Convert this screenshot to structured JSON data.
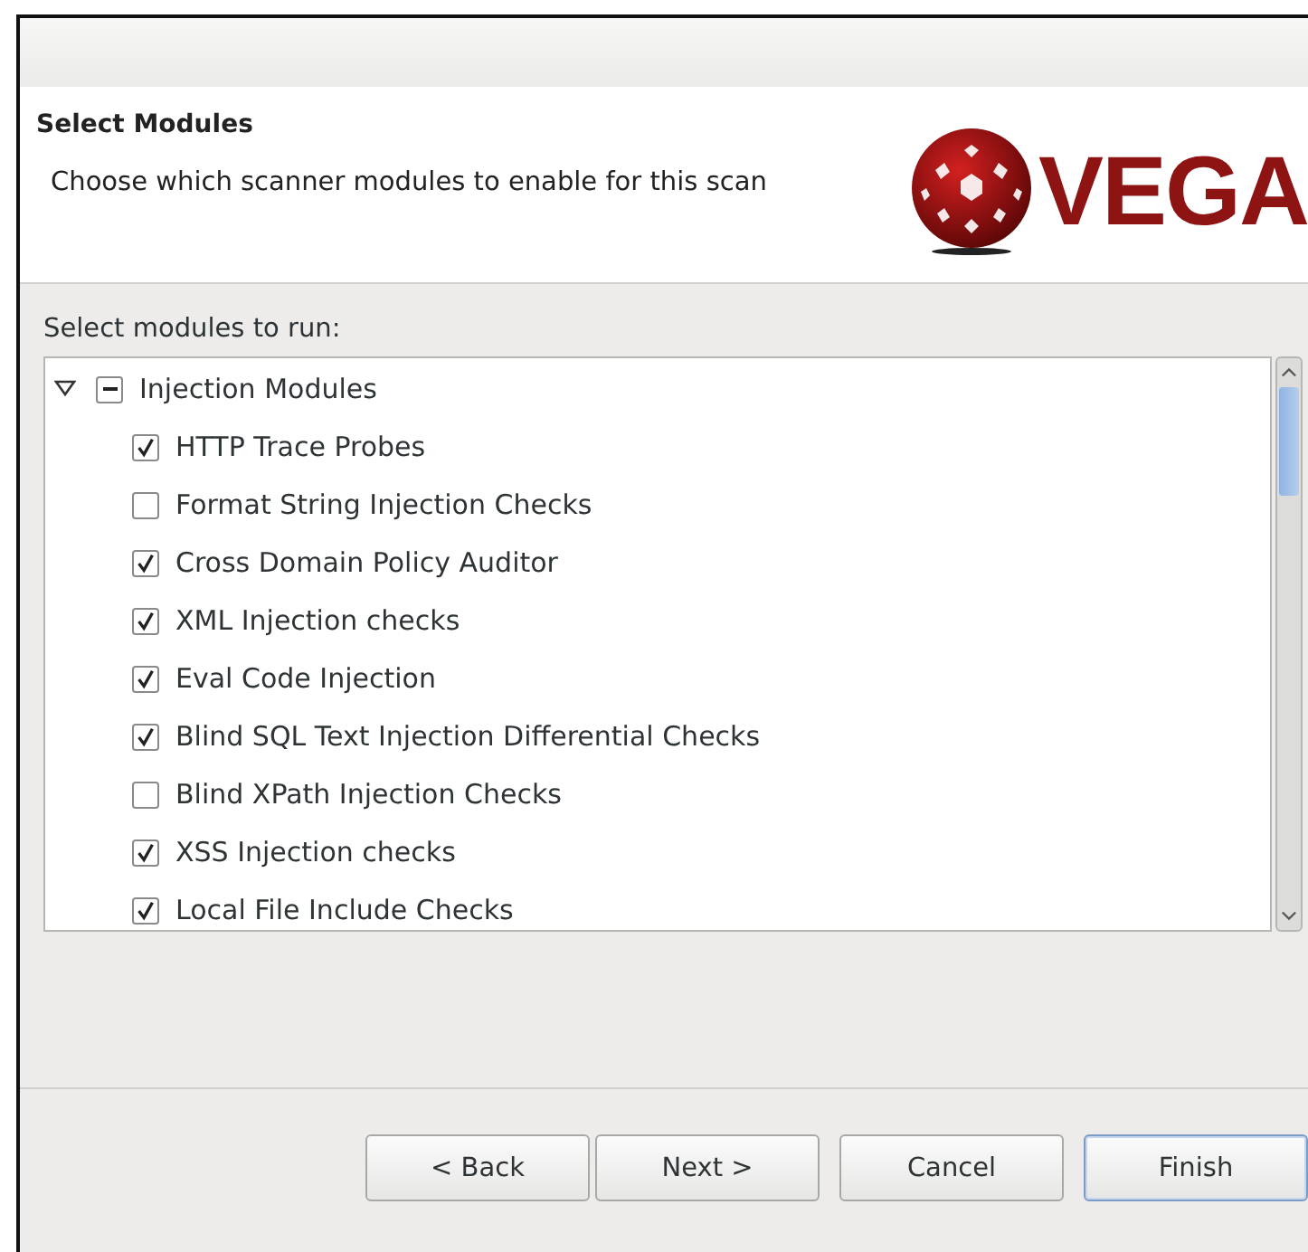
{
  "header": {
    "title": "Select Modules",
    "description": "Choose which scanner modules to enable for this scan",
    "logo_text": "VEGA"
  },
  "modules_label": "Select modules to run:",
  "tree": [
    {
      "label": "Injection Modules",
      "expanded": true,
      "partial": true,
      "children": [
        {
          "label": "HTTP Trace Probes",
          "checked": true
        },
        {
          "label": "Format String Injection Checks",
          "checked": false
        },
        {
          "label": "Cross Domain Policy Auditor",
          "checked": true
        },
        {
          "label": "XML Injection checks",
          "checked": true
        },
        {
          "label": "Eval Code Injection",
          "checked": true
        },
        {
          "label": "Blind SQL Text Injection Differential Checks",
          "checked": true
        },
        {
          "label": "Blind XPath Injection Checks",
          "checked": false
        },
        {
          "label": "XSS Injection checks",
          "checked": true
        },
        {
          "label": "Local File Include Checks",
          "checked": true
        }
      ]
    }
  ],
  "buttons": [
    {
      "label": "< Back",
      "default": false
    },
    {
      "label": "Next >",
      "default": false
    },
    {
      "label": "Cancel",
      "default": false
    },
    {
      "label": "Finish",
      "default": true
    }
  ]
}
